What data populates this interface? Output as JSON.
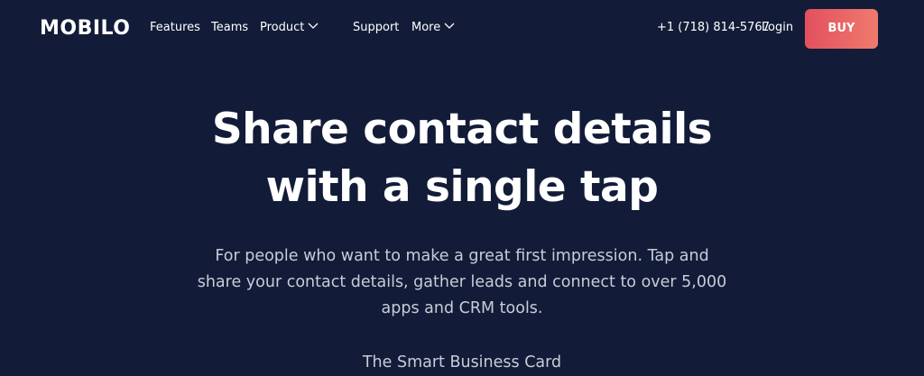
{
  "brand": {
    "logo_text": "MOBILO"
  },
  "nav": {
    "features": "Features",
    "teams": "Teams",
    "product": "Product",
    "support": "Support",
    "more": "More",
    "phone": "+1 (718) 814-5767",
    "login": "Login",
    "buy": "BUY"
  },
  "icons": {
    "product_dropdown": "chevron-down-icon",
    "more_dropdown": "chevron-down-icon"
  },
  "colors": {
    "background": "#121c38",
    "buy_button": "#e85a64",
    "subtext": "#c7ccd8"
  },
  "hero": {
    "title_line1": "Share contact details",
    "title_line2": "with a single tap",
    "subtitle": "For people who want to make a great first impression. Tap and share your contact details, gather leads and connect to over 5,000 apps and CRM tools.",
    "tagline": "The Smart Business Card"
  }
}
